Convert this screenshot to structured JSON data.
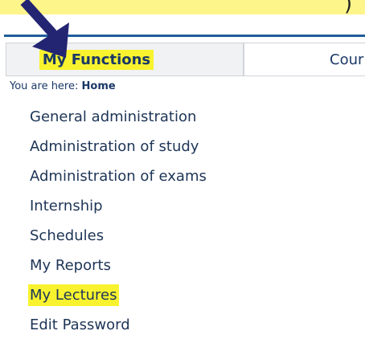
{
  "header": {
    "banner_paren": ")"
  },
  "tabs": [
    {
      "label": "My Functions"
    },
    {
      "label": "Cour"
    }
  ],
  "breadcrumb": {
    "prefix": "You are here: ",
    "home": "Home"
  },
  "menu": {
    "items": [
      {
        "label": "General administration"
      },
      {
        "label": "Administration of study"
      },
      {
        "label": "Administration of exams"
      },
      {
        "label": "Internship"
      },
      {
        "label": "Schedules"
      },
      {
        "label": "My Reports"
      },
      {
        "label": "My Lectures"
      },
      {
        "label": "Edit Password"
      }
    ]
  },
  "colors": {
    "highlight": "#f8f32e",
    "banner": "#fdf58a",
    "arrow": "#232572",
    "accent_line": "#1f5c99"
  },
  "annotation": {
    "icon": "arrow-down-right-icon"
  }
}
